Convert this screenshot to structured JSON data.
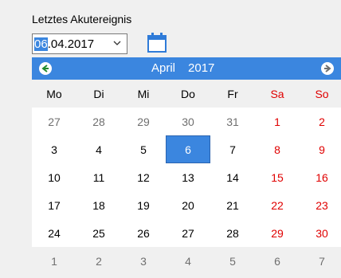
{
  "label": "Letztes Akutereignis",
  "date_input": {
    "day": "06",
    "rest": ".04.2017"
  },
  "header": {
    "month": "April",
    "year": "2017"
  },
  "weekdays": [
    "Mo",
    "Di",
    "Mi",
    "Do",
    "Fr",
    "Sa",
    "So"
  ],
  "weeks": [
    [
      "27",
      "28",
      "29",
      "30",
      "31",
      "1",
      "2"
    ],
    [
      "3",
      "4",
      "5",
      "6",
      "7",
      "8",
      "9"
    ],
    [
      "10",
      "11",
      "12",
      "13",
      "14",
      "15",
      "16"
    ],
    [
      "17",
      "18",
      "19",
      "20",
      "21",
      "22",
      "23"
    ],
    [
      "24",
      "25",
      "26",
      "27",
      "28",
      "29",
      "30"
    ],
    [
      "1",
      "2",
      "3",
      "4",
      "5",
      "6",
      "7"
    ]
  ],
  "selected_day": "6",
  "colors": {
    "accent": "#3b86df",
    "weekend": "#e00000",
    "muted": "#6f6f6f"
  },
  "icons": [
    "chevron-down-icon",
    "calendar-icon",
    "prev-arrow-icon",
    "next-arrow-icon"
  ]
}
